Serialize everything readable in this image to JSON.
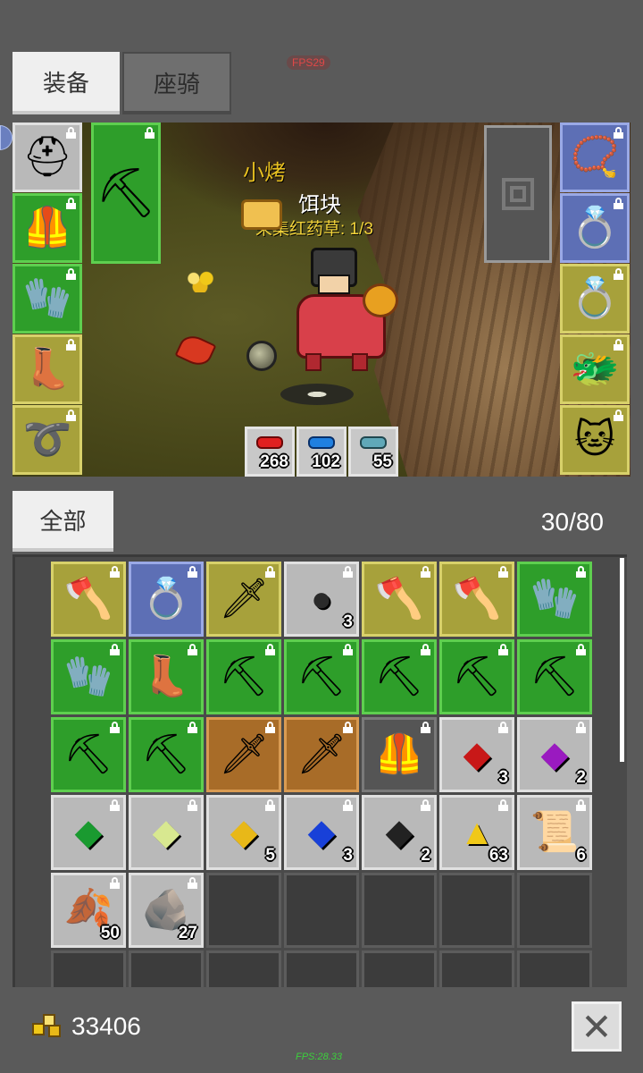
{
  "tabs": {
    "equipment": "装备",
    "mount": "座骑"
  },
  "fps_top": "FPS29",
  "fps_bottom": "FPS:28.33",
  "scene": {
    "pet_name": "小烤",
    "player_name": "饵块",
    "quest": "采集红药草: 1/3",
    "hotbar": [
      {
        "icon": "red-potion-icon",
        "count": "268"
      },
      {
        "icon": "blue-potion-icon",
        "count": "102"
      },
      {
        "icon": "teal-potion-icon",
        "count": "55"
      }
    ]
  },
  "equip_left": [
    {
      "name": "helmet",
      "icon": "horned-helmet-icon",
      "color": "gray",
      "glyph": "⛑"
    },
    {
      "name": "armor",
      "icon": "leather-armor-icon",
      "color": "green",
      "glyph": "🦺"
    },
    {
      "name": "gloves",
      "icon": "gloves-icon",
      "color": "green",
      "glyph": "🧤"
    },
    {
      "name": "boots",
      "icon": "boots-icon",
      "color": "yellow",
      "glyph": "👢"
    },
    {
      "name": "belt",
      "icon": "belt-icon",
      "color": "yellow",
      "glyph": "➰"
    }
  ],
  "equip_weapon": {
    "icon": "pickaxe-icon",
    "glyph": "⛏"
  },
  "equip_right": [
    {
      "name": "necklace",
      "icon": "necklace-icon",
      "color": "blue",
      "glyph": "📿"
    },
    {
      "name": "ring-1",
      "icon": "ring-icon",
      "color": "blue",
      "glyph": "💍"
    },
    {
      "name": "ring-2",
      "icon": "green-ring-icon",
      "color": "yellow",
      "glyph": "💍"
    },
    {
      "name": "pet-card-1",
      "icon": "pet-card-icon",
      "color": "yellow",
      "glyph": "🐲"
    },
    {
      "name": "pet-card-2",
      "icon": "pet-card-icon",
      "color": "yellow",
      "glyph": "🐱"
    }
  ],
  "filter": "全部",
  "capacity": "30/80",
  "inventory": [
    {
      "icon": "axe-icon",
      "color": "yellow",
      "glyph": "🪓",
      "count": ""
    },
    {
      "icon": "green-ring-icon",
      "color": "blue",
      "glyph": "💍",
      "count": ""
    },
    {
      "icon": "sword-icon",
      "color": "yellow",
      "glyph": "🗡",
      "count": ""
    },
    {
      "icon": "black-stone-icon",
      "color": "gray",
      "glyph": "●",
      "count": "3"
    },
    {
      "icon": "axe-icon",
      "color": "yellow",
      "glyph": "🪓",
      "count": ""
    },
    {
      "icon": "axe-icon",
      "color": "yellow",
      "glyph": "🪓",
      "count": ""
    },
    {
      "icon": "gloves-icon",
      "color": "green",
      "glyph": "🧤",
      "count": ""
    },
    {
      "icon": "gloves-icon",
      "color": "green",
      "glyph": "🧤",
      "count": ""
    },
    {
      "icon": "boots-icon",
      "color": "green",
      "glyph": "👢",
      "count": ""
    },
    {
      "icon": "pickaxe-icon",
      "color": "green",
      "glyph": "⛏",
      "count": ""
    },
    {
      "icon": "pickaxe-icon",
      "color": "green",
      "glyph": "⛏",
      "count": ""
    },
    {
      "icon": "pickaxe-icon",
      "color": "green",
      "glyph": "⛏",
      "count": ""
    },
    {
      "icon": "pickaxe-icon",
      "color": "green",
      "glyph": "⛏",
      "count": ""
    },
    {
      "icon": "pickaxe-icon",
      "color": "green",
      "glyph": "⛏",
      "count": ""
    },
    {
      "icon": "pickaxe-icon",
      "color": "green",
      "glyph": "⛏",
      "count": ""
    },
    {
      "icon": "pickaxe-icon",
      "color": "green",
      "glyph": "⛏",
      "count": ""
    },
    {
      "icon": "dagger-icon",
      "color": "orange",
      "glyph": "🗡",
      "count": ""
    },
    {
      "icon": "dagger-icon",
      "color": "orange",
      "glyph": "🗡",
      "count": ""
    },
    {
      "icon": "dark-armor-icon",
      "color": "dark",
      "glyph": "🦺",
      "count": ""
    },
    {
      "icon": "red-gem-icon",
      "color": "gray",
      "glyph": "◆",
      "count": "3"
    },
    {
      "icon": "purple-gem-icon",
      "color": "gray",
      "glyph": "◆",
      "count": "2"
    },
    {
      "icon": "green-gem-icon",
      "color": "gray",
      "glyph": "◆",
      "count": ""
    },
    {
      "icon": "pale-gem-icon",
      "color": "gray",
      "glyph": "◆",
      "count": ""
    },
    {
      "icon": "yellow-gem-icon",
      "color": "gray",
      "glyph": "◆",
      "count": "5"
    },
    {
      "icon": "blue-gem-icon",
      "color": "gray",
      "glyph": "◆",
      "count": "3"
    },
    {
      "icon": "black-gem-icon",
      "color": "gray",
      "glyph": "◆",
      "count": "2"
    },
    {
      "icon": "gold-pile-icon",
      "color": "gray",
      "glyph": "▲",
      "count": "63"
    },
    {
      "icon": "scroll-icon",
      "color": "gray",
      "glyph": "📜",
      "count": "6"
    },
    {
      "icon": "red-leaf-icon",
      "color": "gray",
      "glyph": "🍂",
      "count": "50"
    },
    {
      "icon": "ore-icon",
      "color": "gray",
      "glyph": "🪨",
      "count": "27"
    }
  ],
  "colors": {
    "red-gem-icon": "#c81818",
    "purple-gem-icon": "#9a1ac0",
    "green-gem-icon": "#1a9a30",
    "pale-gem-icon": "#d8e890",
    "yellow-gem-icon": "#e8b818",
    "blue-gem-icon": "#1840d8",
    "black-gem-icon": "#222222",
    "black-stone-icon": "#2a2a2a",
    "gold-pile-icon": "#f0c818"
  },
  "gold": "33406"
}
